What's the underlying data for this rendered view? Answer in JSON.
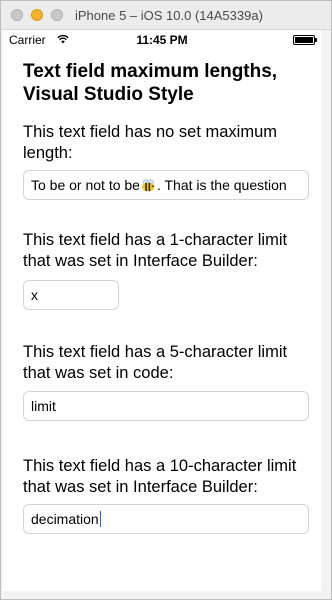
{
  "window": {
    "title": "iPhone 5 – iOS 10.0 (14A5339a)"
  },
  "status_bar": {
    "carrier": "Carrier",
    "time": "11:45 PM",
    "battery_level": 1.0
  },
  "screen": {
    "heading": "Text field maximum lengths, Visual Studio Style",
    "sections": [
      {
        "label": "This text field has no set maximum length:",
        "value_before_emoji": "To be or not to be",
        "emoji": "bee",
        "value_after_emoji": ". That is the question"
      },
      {
        "label": "This text field has a 1-character limit that was set in Interface Builder:",
        "value": "x"
      },
      {
        "label": "This text field has a 5-character limit that was set in code:",
        "value": "limit"
      },
      {
        "label": "This text field has a 10-character limit that was set in Interface Builder:",
        "value": "decimation"
      }
    ]
  }
}
